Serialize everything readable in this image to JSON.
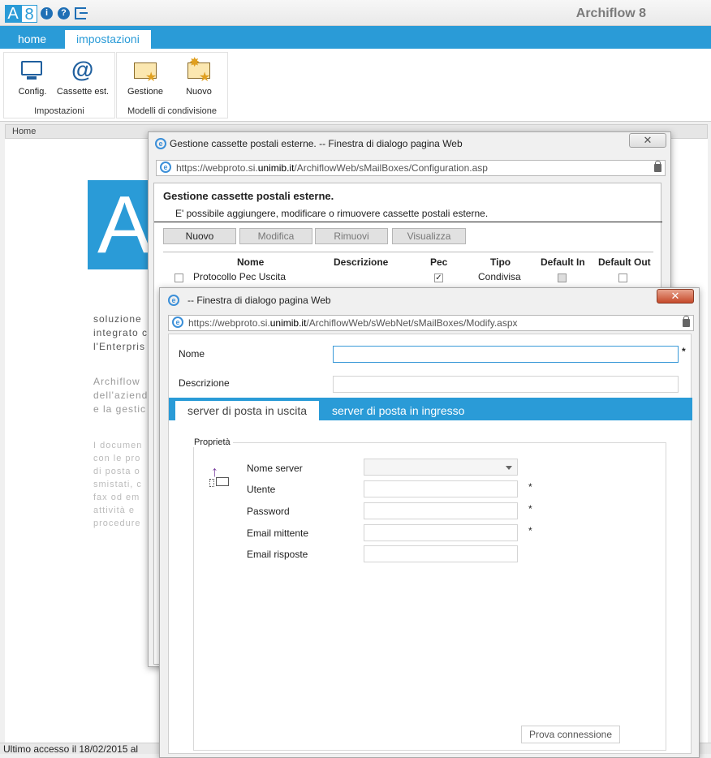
{
  "topbar": {
    "logo_a": "A",
    "logo_8": "8",
    "icons": [
      "info-icon",
      "help-icon",
      "exit-icon"
    ],
    "app_title": "Archiflow 8"
  },
  "tabs": [
    {
      "label": "home",
      "active": false
    },
    {
      "label": "impostazioni",
      "active": true
    }
  ],
  "ribbon": {
    "groups": [
      {
        "label": "Impostazioni",
        "buttons": [
          {
            "label": "Config.",
            "icon": "monitor-icon"
          },
          {
            "label": "Cassette est.",
            "icon": "mailbox-at-icon"
          }
        ]
      },
      {
        "label": "Modelli di condivisione",
        "buttons": [
          {
            "label": "Gestione",
            "icon": "envelope-star-icon"
          },
          {
            "label": "Nuovo",
            "icon": "envelope-new-icon"
          }
        ]
      }
    ]
  },
  "breadcrumb": "Home",
  "background": {
    "big_logo": "A",
    "para1": "soluzione\nintegrato c\nl'Enterpris",
    "para2": "Archiflow\ndell'aziend\ne la gestic",
    "para3": "I documen\ncon le pro\ndi posta o\nsmistati, c\nfax od em\nattività e\nprocedure"
  },
  "status": "Ultimo accesso il 18/02/2015 al",
  "dialog1": {
    "title": "Gestione cassette postali esterne. -- Finestra di dialogo pagina Web",
    "url_scheme": "https://webproto.si.",
    "url_domain": "unimib.it",
    "url_path": "/ArchiflowWeb/sMailBoxes/Configuration.asp",
    "heading": "Gestione cassette postali esterne.",
    "description": "E' possibile aggiungere, modificare o rimuovere cassette postali esterne.",
    "buttons": [
      "Nuovo",
      "Modifica",
      "Rimuovi",
      "Visualizza"
    ],
    "columns": [
      "Nome",
      "Descrizione",
      "Pec",
      "Tipo",
      "Default In",
      "Default Out"
    ],
    "rows": [
      {
        "name": "Protocollo Pec Uscita",
        "descrizione": "",
        "pec": true,
        "tipo": "Condivisa",
        "default_in": false,
        "default_out": false
      }
    ],
    "close": "✕"
  },
  "dialog2": {
    "title": "-- Finestra di dialogo pagina Web",
    "url_scheme": "https://webproto.si.",
    "url_domain": "unimib.it",
    "url_path": "/ArchiflowWeb/sWebNet/sMailBoxes/Modify.aspx",
    "nome_label": "Nome",
    "nome_value": "",
    "nome_required": "*",
    "descrizione_label": "Descrizione",
    "descrizione_value": "",
    "tabs": [
      "server di posta in uscita",
      "server di posta in ingresso"
    ],
    "legend": "Proprietà",
    "fields": [
      {
        "label": "Nome server",
        "value": "",
        "required": ""
      },
      {
        "label": "Utente",
        "value": "",
        "required": "*"
      },
      {
        "label": "Password",
        "value": "",
        "required": "*"
      },
      {
        "label": "Email mittente",
        "value": "",
        "required": "*"
      },
      {
        "label": "Email risposte",
        "value": "",
        "required": ""
      }
    ],
    "test_button": "Prova connessione",
    "close": "✕"
  },
  "colors": {
    "accent": "#2a9bd7",
    "close_red": "#c64a2b"
  }
}
